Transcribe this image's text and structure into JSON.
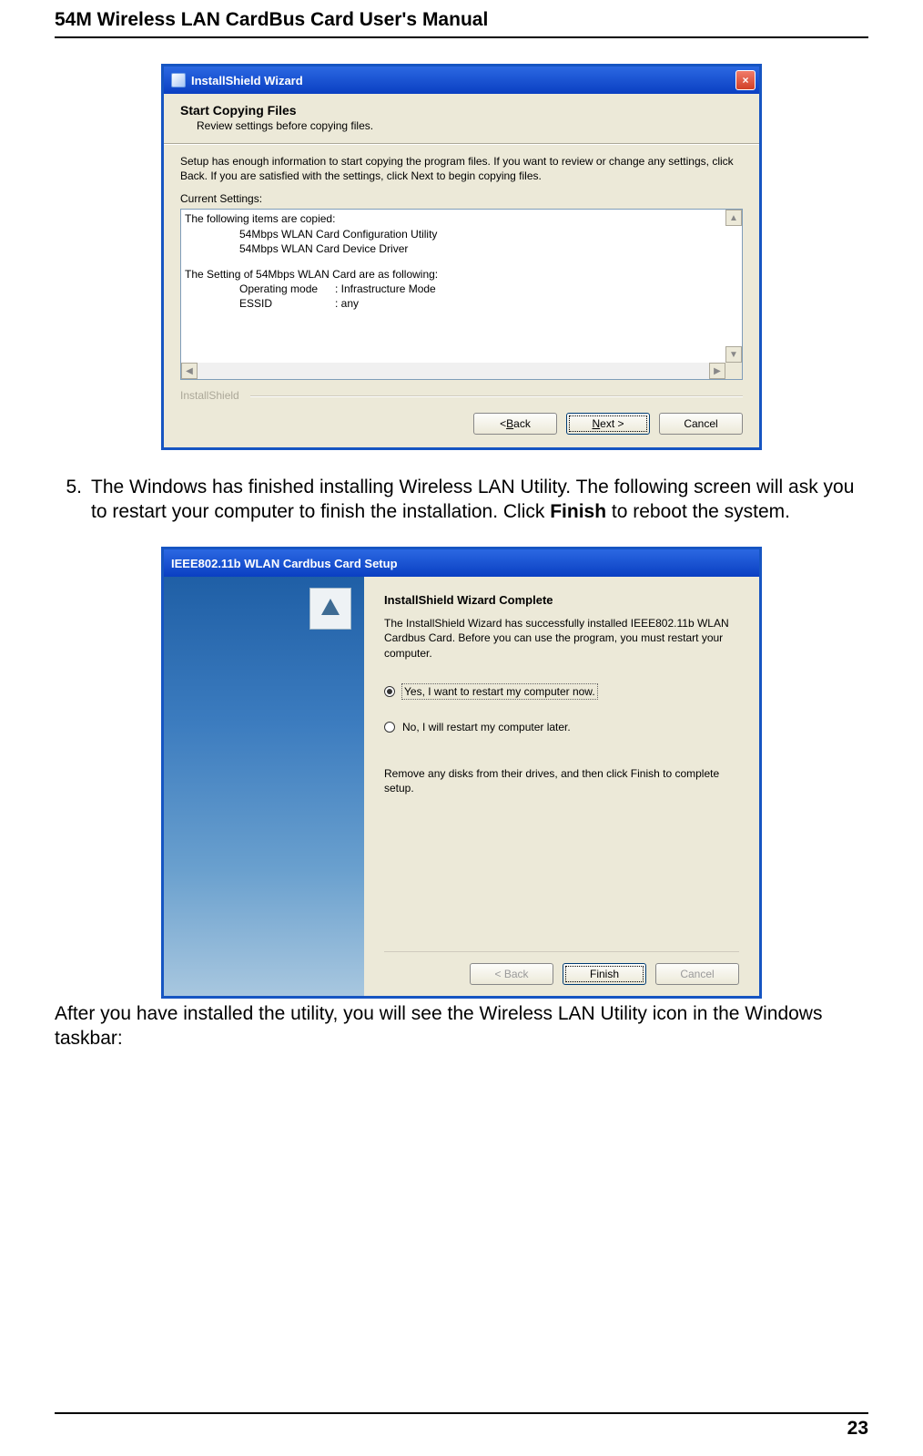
{
  "doc": {
    "header": "54M Wireless LAN CardBus Card User's Manual",
    "page_number": "23",
    "step5_num": "5.",
    "step5_text_pre": "The Windows has finished installing Wireless LAN Utility. The following screen will ask you to restart your computer to finish the installation. Click ",
    "step5_bold": "Finish",
    "step5_text_post": " to reboot the system.",
    "after_text": "After you have installed the utility, you will see the Wireless LAN Utility icon in the Windows taskbar:"
  },
  "dlg1": {
    "title": "InstallShield Wizard",
    "close_icon": "×",
    "heading": "Start Copying Files",
    "subheading": "Review settings before copying files.",
    "instruction": "Setup has enough information to start copying the program files.  If you want to review or change any settings, click Back.  If you are satisfied with the settings, click Next to begin copying files.",
    "current_settings_label": "Current Settings:",
    "list": {
      "copied_header": "The following items are copied:",
      "copied_items": [
        "54Mbps WLAN Card Configuration Utility",
        "54Mbps WLAN Card Device Driver"
      ],
      "settings_header": "The Setting of 54Mbps WLAN Card are as following:",
      "settings_rows": [
        {
          "k": "Operating mode",
          "v": ": Infrastructure Mode"
        },
        {
          "k": "ESSID",
          "v": ": any"
        }
      ]
    },
    "brand": "InstallShield",
    "buttons": {
      "back_pre": "< ",
      "back_u": "B",
      "back_post": "ack",
      "next_u": "N",
      "next_post": "ext >",
      "cancel": "Cancel"
    }
  },
  "dlg2": {
    "title": "IEEE802.11b WLAN Cardbus Card Setup",
    "heading": "InstallShield Wizard Complete",
    "para1": "The InstallShield Wizard has successfully installed IEEE802.11b WLAN Cardbus Card.  Before you can use the program, you must restart your computer.",
    "radio_yes": "Yes, I want to restart my computer now.",
    "radio_no": "No, I will restart my computer later.",
    "para2": "Remove any disks from their drives, and then click Finish to complete setup.",
    "buttons": {
      "back": "< Back",
      "finish": "Finish",
      "cancel": "Cancel"
    }
  }
}
